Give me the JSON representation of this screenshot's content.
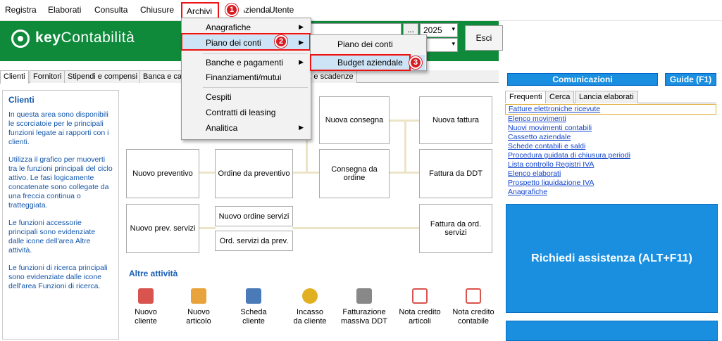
{
  "menubar": {
    "items": [
      "Registra",
      "Elaborati",
      "Consulta",
      "Chiusure",
      "Archivi",
      "Azienda",
      "Utente"
    ]
  },
  "header": {
    "logo_bold": "key",
    "logo_rest": "Contabilità",
    "year": "2025",
    "dots": "...",
    "exit_label": "Esci"
  },
  "tabs": [
    "Clienti",
    "Fornitori",
    "Stipendi e compensi",
    "Banca e ca",
    "nda e scadenze"
  ],
  "left": {
    "title": "Clienti",
    "p1": "In questa area sono disponibili le scorciatoie per le principali funzioni legate ai rapporti con i clienti.",
    "p2": "Utilizza il grafico per muoverti tra le funzioni principali del ciclo attivo. Le fasi logicamente concatenate sono collegate da una freccia continua o tratteggiata.",
    "p3": "Le funzioni accessorie principali sono evidenziate dalle icone dell'area Altre attività.",
    "p4": "Le funzioni di ricerca principali sono evidenziate dalle icone dell'area Funzioni di ricerca."
  },
  "flow": {
    "nuova_consegna": "Nuova consegna",
    "nuova_fattura": "Nuova fattura",
    "nuovo_preventivo": "Nuovo preventivo",
    "ordine_da_preventivo": "Ordine da preventivo",
    "consegna_da_ordine": "Consegna da ordine",
    "fattura_da_ddt": "Fattura da DDT",
    "nuovo_prev_servizi": "Nuovo prev. servizi",
    "nuovo_ordine_servizi": "Nuovo ordine servizi",
    "ord_servizi_da_prev": "Ord. servizi da prev.",
    "fattura_da_ord_servizi": "Fattura da ord. servizi"
  },
  "altre": {
    "title": "Altre attività",
    "items": [
      {
        "label1": "Nuovo",
        "label2": "cliente",
        "icon": "users-icon",
        "color": "#d9534f"
      },
      {
        "label1": "Nuovo",
        "label2": "articolo",
        "icon": "box-icon",
        "color": "#e8a33c"
      },
      {
        "label1": "Scheda",
        "label2": "cliente",
        "icon": "card-icon",
        "color": "#4a7ab8"
      },
      {
        "label1": "Incasso",
        "label2": "da cliente",
        "icon": "coins-icon",
        "color": "#e0b020"
      },
      {
        "label1": "Fatturazione",
        "label2": "massiva DDT",
        "icon": "printer-icon",
        "color": "#888888"
      },
      {
        "label1": "Nota credito",
        "label2": "articoli",
        "icon": "note-icon",
        "color": "#d9534f"
      },
      {
        "label1": "Nota credito",
        "label2": "contabile",
        "icon": "note-icon",
        "color": "#d9534f"
      }
    ]
  },
  "right": {
    "comunicazioni": "Comunicazioni",
    "guide": "Guide (F1)",
    "tabs": [
      "Frequenti",
      "Cerca",
      "Lancia elaborati"
    ],
    "links": [
      "Fatture elettroniche ricevute",
      "Elenco movimenti",
      "Nuovi movimenti contabili",
      "Cassetto aziendale",
      "Schede contabili e saldi",
      "Procedura guidata di chiusura periodi",
      "Lista controllo Registri IVA",
      "Elenco elaborati",
      "Prospetto liquidazione IVA",
      "Anagrafiche"
    ],
    "assist": "Richiedi assistenza  (ALT+F11)"
  },
  "archivi_menu": {
    "items": [
      "Anagrafiche",
      "Piano dei conti",
      "Banche e pagamenti",
      "Finanziamenti/mutui",
      "Cespiti",
      "Contratti di leasing",
      "Analitica"
    ]
  },
  "piano_submenu": {
    "items": [
      "Piano dei conti",
      "Budget aziendale"
    ]
  },
  "badges": [
    "1",
    "2",
    "3"
  ],
  "colors": {
    "green": "#0e8a3a",
    "blue": "#1a8fe0",
    "highlight": "#cde4f7",
    "red": "#e11111"
  }
}
